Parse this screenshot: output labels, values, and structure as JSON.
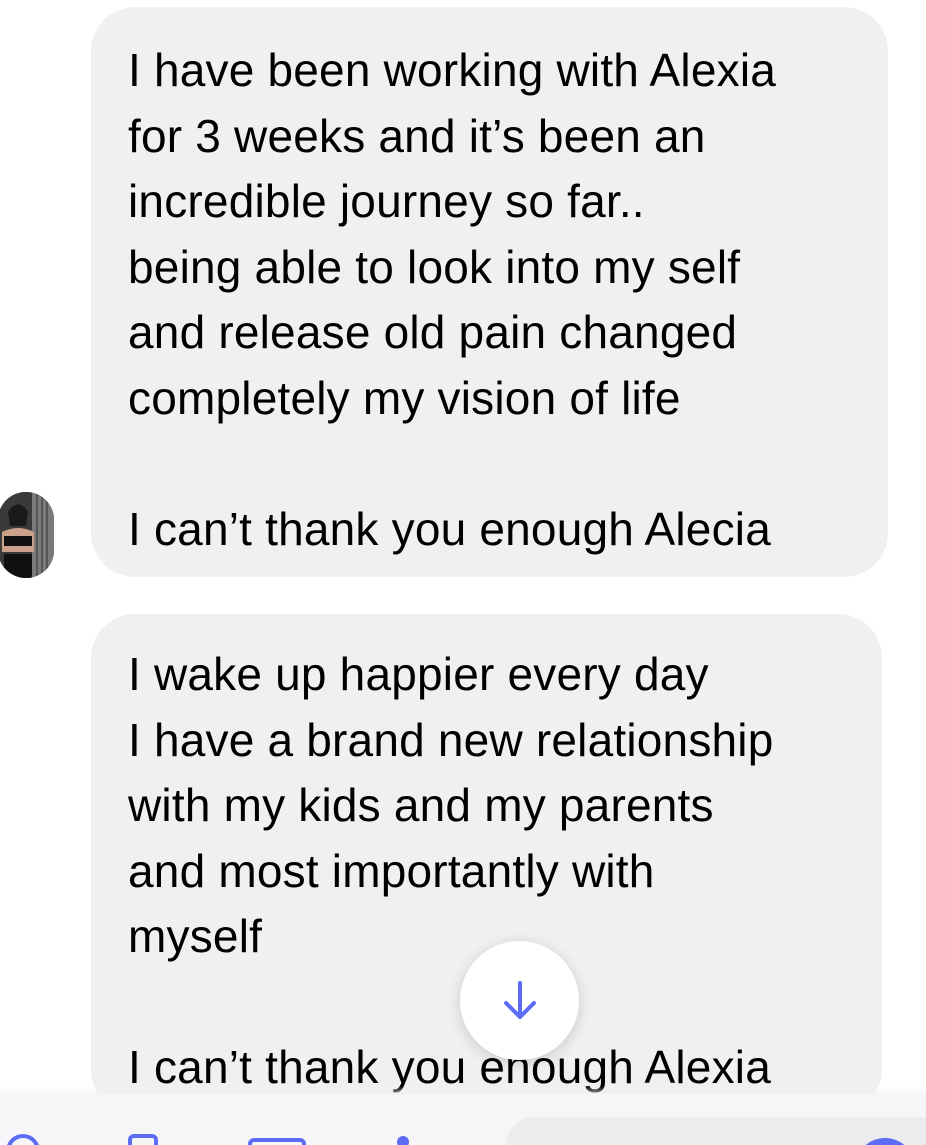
{
  "conversation": {
    "messages": [
      {
        "lines": [
          "I have been working with Alexia",
          "for 3 weeks and it’s been an",
          "incredible journey so far..",
          "being able to look into my self",
          "and release old pain changed",
          "completely my vision of life",
          "",
          "I can’t thank you enough Alecia"
        ]
      },
      {
        "lines": [
          "I wake up happier every day",
          "I have a brand new relationship",
          "with my kids and my parents",
          "and most importantly with",
          "myself",
          "",
          "I can’t thank you enough Alexia"
        ]
      }
    ]
  },
  "scroll_button": {
    "icon": "arrow-down-icon"
  },
  "composer": {
    "icons": [
      "camera-icon",
      "image-icon",
      "microphone-icon",
      "more-icon",
      "emoji-icon"
    ]
  },
  "colors": {
    "accent": "#5c6cf5",
    "bubble_background": "#f0f0f0",
    "text": "#000000"
  }
}
